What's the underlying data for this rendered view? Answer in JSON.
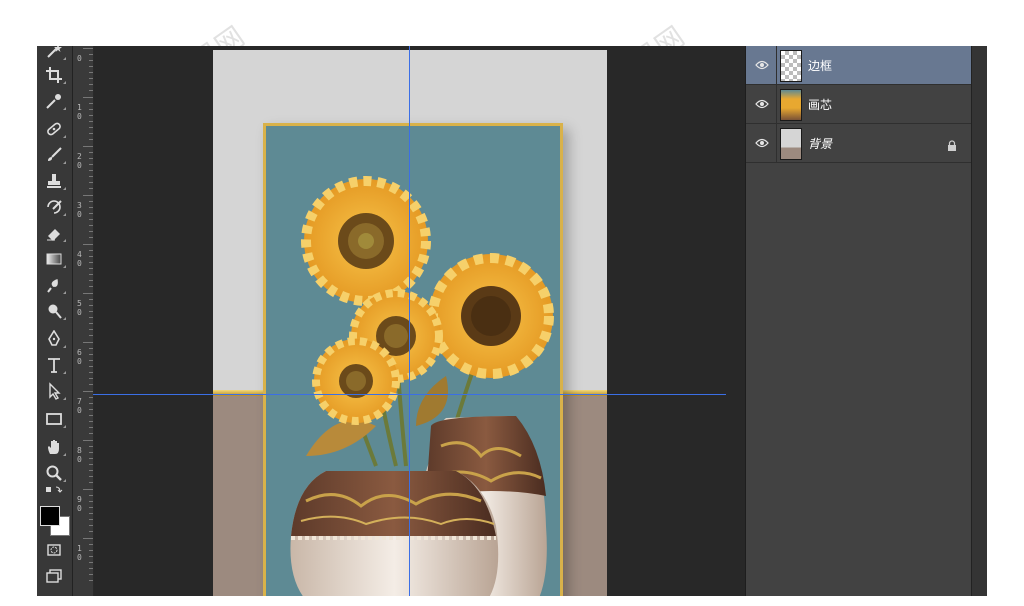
{
  "toolbar": {
    "tools": [
      {
        "icon": "magic-wand-icon"
      },
      {
        "icon": "crop-icon"
      },
      {
        "icon": "eyedropper-icon"
      },
      {
        "icon": "healing-brush-icon"
      },
      {
        "icon": "brush-icon"
      },
      {
        "icon": "clone-stamp-icon"
      },
      {
        "icon": "history-brush-icon"
      },
      {
        "icon": "eraser-icon"
      },
      {
        "icon": "gradient-icon"
      },
      {
        "icon": "blur-icon"
      },
      {
        "icon": "dodge-icon"
      },
      {
        "icon": "pen-icon"
      },
      {
        "icon": "type-icon"
      },
      {
        "icon": "path-selection-icon"
      },
      {
        "icon": "rectangle-icon"
      },
      {
        "icon": "hand-icon"
      },
      {
        "icon": "zoom-icon"
      }
    ],
    "foreground_color": "#000000",
    "background_color": "#ffffff"
  },
  "ruler": {
    "ticks": [
      "0",
      "1\n0",
      "2\n0",
      "3\n0",
      "4\n0",
      "5\n0",
      "6\n0",
      "7\n0",
      "8\n0",
      "9\n0",
      "1\n0"
    ]
  },
  "canvas": {
    "wall_color": "#d5d5d5",
    "floor_color": "#9c8a7f",
    "painting_bg": "#5e8a94",
    "frame_color": "#d9b24a",
    "guide_color": "#3b6fe6"
  },
  "layers": [
    {
      "name": "边框",
      "active": true,
      "locked": false
    },
    {
      "name": "画芯",
      "active": false,
      "locked": false
    },
    {
      "name": "背景",
      "active": false,
      "locked": true
    }
  ],
  "colors": {
    "active_layer": "#687891",
    "panel": "#424242"
  }
}
